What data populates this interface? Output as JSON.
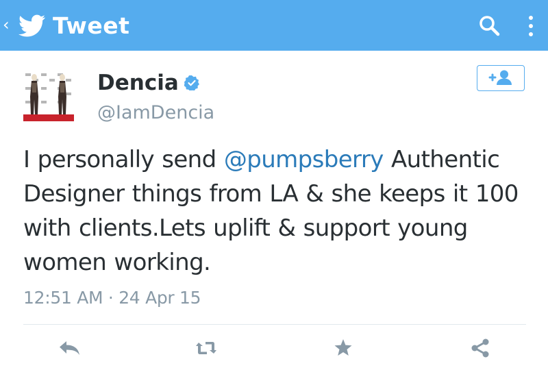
{
  "topbar": {
    "title": "Tweet",
    "back_glyph": "‹",
    "icons": [
      "chevron-left-icon",
      "twitter-bird-icon",
      "search-icon",
      "overflow-menu-icon"
    ],
    "color": "#55acee"
  },
  "tweet": {
    "author": {
      "name": "Dencia",
      "handle": "@IamDencia",
      "verified": true,
      "avatar_icon": "avatar"
    },
    "follow_button_icon": "add-user-icon",
    "text_lines": [
      {
        "before": "I personally send ",
        "mention": "@pumpsberry",
        "after": " Authentic"
      },
      "Designer things from LA & she keeps it 100",
      "with clients.Lets uplift & support young",
      "women working."
    ],
    "timestamp": "12:51 AM · 24 Apr 15"
  },
  "actions": [
    "reply-icon",
    "retweet-icon",
    "favorite-icon",
    "share-icon"
  ],
  "colors": {
    "accent": "#55acee",
    "link": "#2b7bb9",
    "text": "#292f33",
    "muted": "#8899a6",
    "action_icon": "#8899a6"
  }
}
